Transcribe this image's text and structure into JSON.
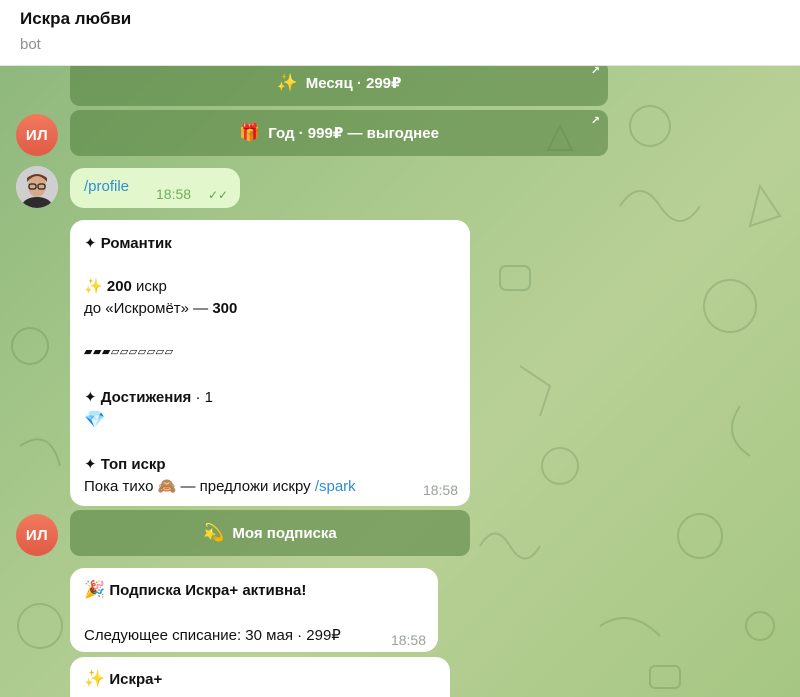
{
  "header": {
    "title": "Искра любви",
    "subtitle": "bot"
  },
  "avatars": {
    "bot_initials": "ИЛ"
  },
  "keyboard_top": [
    {
      "emoji": "✨",
      "label": "Месяц · 299₽",
      "arrow": "↗"
    },
    {
      "emoji": "🎁",
      "label": "Год · 999₽ — выгоднее",
      "arrow": "↗"
    }
  ],
  "user_msg": {
    "text": "/profile",
    "time": "18:58",
    "ticks": "✓✓"
  },
  "profile_msg": {
    "rank": "✦ Романтик",
    "sparks_emoji": "✨",
    "sparks": "200",
    "sparks_word": " искр",
    "next_prefix": "до «Искромёт» — ",
    "next_value": "300",
    "progress_bar": "▰▰▰▱▱▱▱▱▱▱",
    "achievements_label": "✦ Достижения",
    "achievements_count": " · 1",
    "achievement_emoji": "💎",
    "top_label": "✦ Топ искр",
    "top_text": "Пока тихо 🙈 — предложи искру ",
    "top_link": "/spark",
    "time": "18:58"
  },
  "sub_button": {
    "emoji": "💫",
    "label": "Моя подписка"
  },
  "sub_msg": {
    "emoji": "🎉",
    "title": "Подписка Искра+ активна!",
    "next_charge": "Следующее списание: 30 мая · 299₽",
    "time": "18:58"
  },
  "partial_msg": {
    "emoji": "✨",
    "title": "Искра+"
  }
}
